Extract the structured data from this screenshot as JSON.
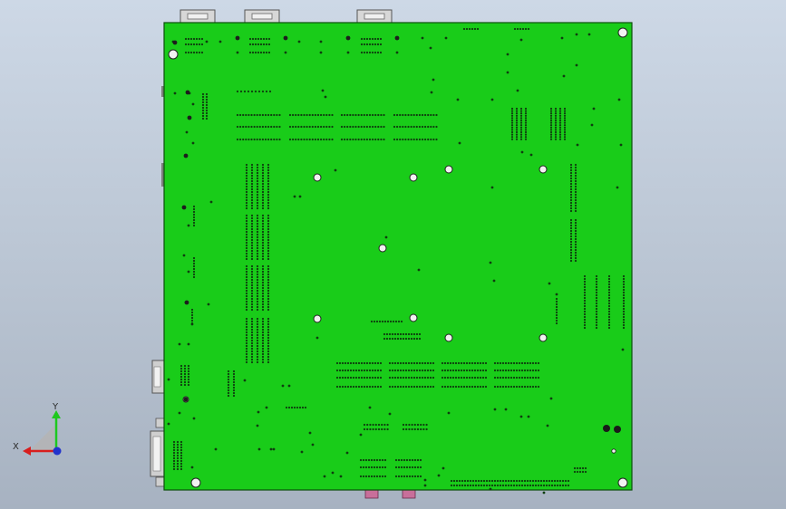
{
  "viewport": {
    "background": "#bac5d3",
    "board_color": "#19cc19",
    "board_edge": "#0b4f0b",
    "hole_color": "#0f3d0f",
    "connector_metal": "#c9c9c9",
    "audio_jack_color": "#c86f9a"
  },
  "triad": {
    "y_label": "Y",
    "x_label": "X",
    "y_color": "#1ec81e",
    "x_color": "#d81e1e",
    "z_color": "#2233cc"
  }
}
